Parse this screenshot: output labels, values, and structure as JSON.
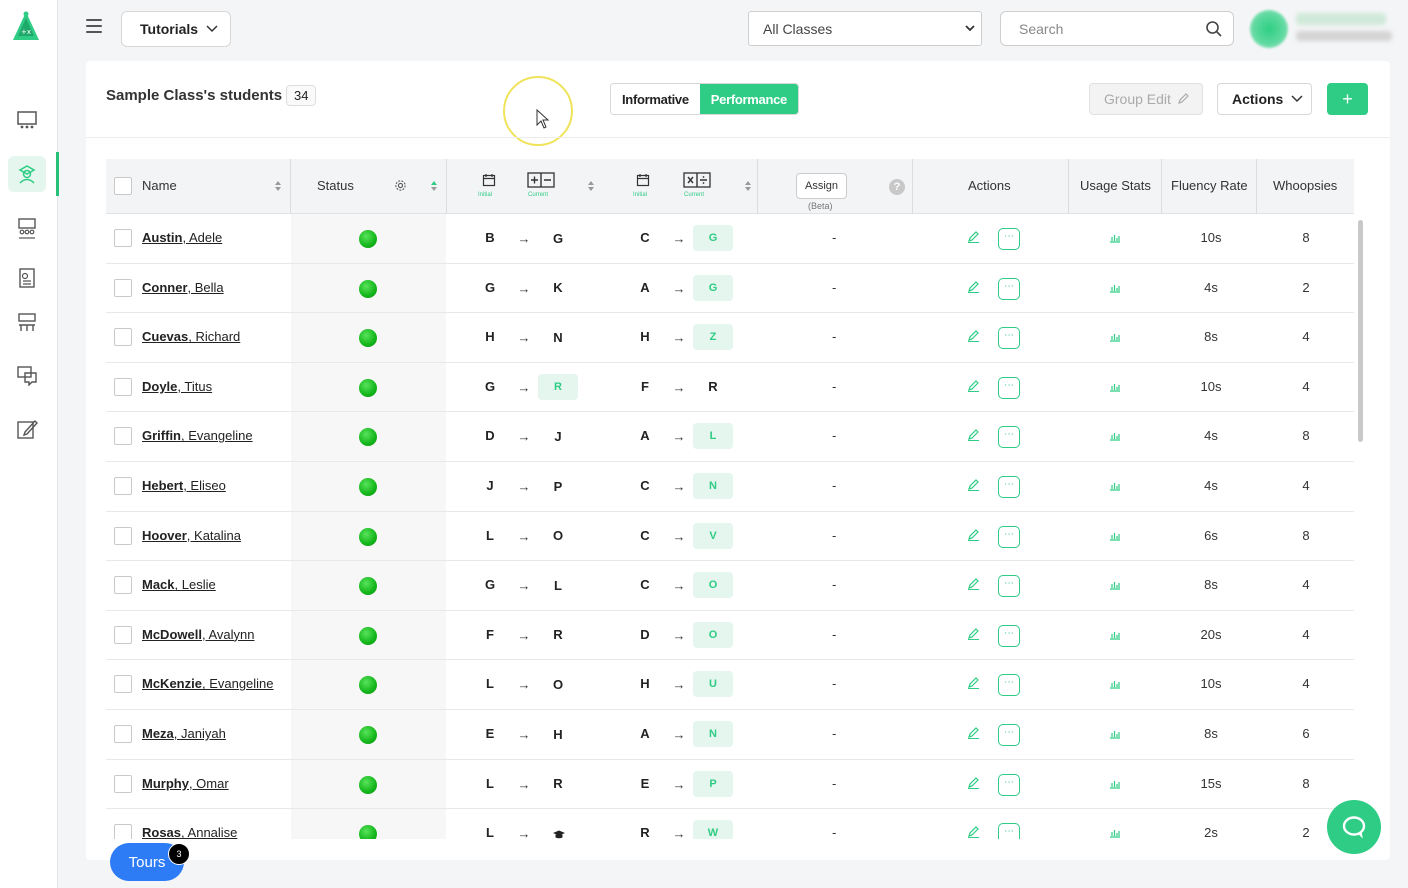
{
  "header": {
    "tutorials_label": "Tutorials",
    "class_select_value": "All Classes",
    "search_placeholder": "Search"
  },
  "card": {
    "title": "Sample Class's students",
    "student_count": "34",
    "view_toggle": {
      "informative": "Informative",
      "performance": "Performance",
      "active": "Performance"
    },
    "group_edit_label": "Group Edit",
    "actions_label": "Actions",
    "add_label": "+"
  },
  "table": {
    "columns": {
      "name": "Name",
      "status": "Status",
      "initial_label": "Initial",
      "current_label": "Current",
      "assign": "Assign",
      "assign_sub": "(Beta)",
      "actions": "Actions",
      "usage_stats": "Usage Stats",
      "fluency_rate": "Fluency Rate",
      "whoopsies": "Whoopsies"
    },
    "rows": [
      {
        "last": "Austin",
        "first": ", Adele",
        "ra_initial": "B",
        "ra_current": "G",
        "m_initial": "C",
        "m_current": "G",
        "assign": "-",
        "fluency": "10s",
        "whoopsies": "8"
      },
      {
        "last": "Conner",
        "first": ", Bella",
        "ra_initial": "G",
        "ra_current": "K",
        "m_initial": "A",
        "m_current": "G",
        "assign": "-",
        "fluency": "4s",
        "whoopsies": "2"
      },
      {
        "last": "Cuevas",
        "first": ", Richard",
        "ra_initial": "H",
        "ra_current": "N",
        "m_initial": "H",
        "m_current": "Z",
        "assign": "-",
        "fluency": "8s",
        "whoopsies": "4"
      },
      {
        "last": "Doyle",
        "first": ", Titus",
        "ra_initial": "G",
        "ra_current": "R",
        "m_initial": "F",
        "m_current": "R",
        "assign": "-",
        "fluency": "10s",
        "whoopsies": "4"
      },
      {
        "last": "Griffin",
        "first": ", Evangeline",
        "ra_initial": "D",
        "ra_current": "J",
        "m_initial": "A",
        "m_current": "L",
        "assign": "-",
        "fluency": "4s",
        "whoopsies": "8"
      },
      {
        "last": "Hebert",
        "first": ", Eliseo",
        "ra_initial": "J",
        "ra_current": "P",
        "m_initial": "C",
        "m_current": "N",
        "assign": "-",
        "fluency": "4s",
        "whoopsies": "4"
      },
      {
        "last": "Hoover",
        "first": ", Katalina",
        "ra_initial": "L",
        "ra_current": "O",
        "m_initial": "C",
        "m_current": "V",
        "assign": "-",
        "fluency": "6s",
        "whoopsies": "8"
      },
      {
        "last": "Mack",
        "first": ", Leslie",
        "ra_initial": "G",
        "ra_current": "L",
        "m_initial": "C",
        "m_current": "O",
        "assign": "-",
        "fluency": "8s",
        "whoopsies": "4"
      },
      {
        "last": "McDowell",
        "first": ", Avalynn",
        "ra_initial": "F",
        "ra_current": "R",
        "m_initial": "D",
        "m_current": "O",
        "assign": "-",
        "fluency": "20s",
        "whoopsies": "4"
      },
      {
        "last": "McKenzie",
        "first": ", Evangeline",
        "ra_initial": "L",
        "ra_current": "O",
        "m_initial": "H",
        "m_current": "U",
        "assign": "-",
        "fluency": "10s",
        "whoopsies": "4"
      },
      {
        "last": "Meza",
        "first": ", Janiyah",
        "ra_initial": "E",
        "ra_current": "H",
        "m_initial": "A",
        "m_current": "N",
        "assign": "-",
        "fluency": "8s",
        "whoopsies": "6"
      },
      {
        "last": "Murphy",
        "first": ", Omar",
        "ra_initial": "L",
        "ra_current": "R",
        "m_initial": "E",
        "m_current": "P",
        "assign": "-",
        "fluency": "15s",
        "whoopsies": "8"
      },
      {
        "last": "Rosas",
        "first": ", Annalise",
        "ra_initial": "L",
        "ra_current": "",
        "m_initial": "R",
        "m_current": "W",
        "assign": "-",
        "fluency": "2s",
        "whoopsies": "2"
      }
    ]
  },
  "footer": {
    "tours_label": "Tours",
    "tours_badge": "3"
  },
  "colors": {
    "accent": "#2ecc85",
    "tours": "#2d7cf6"
  }
}
